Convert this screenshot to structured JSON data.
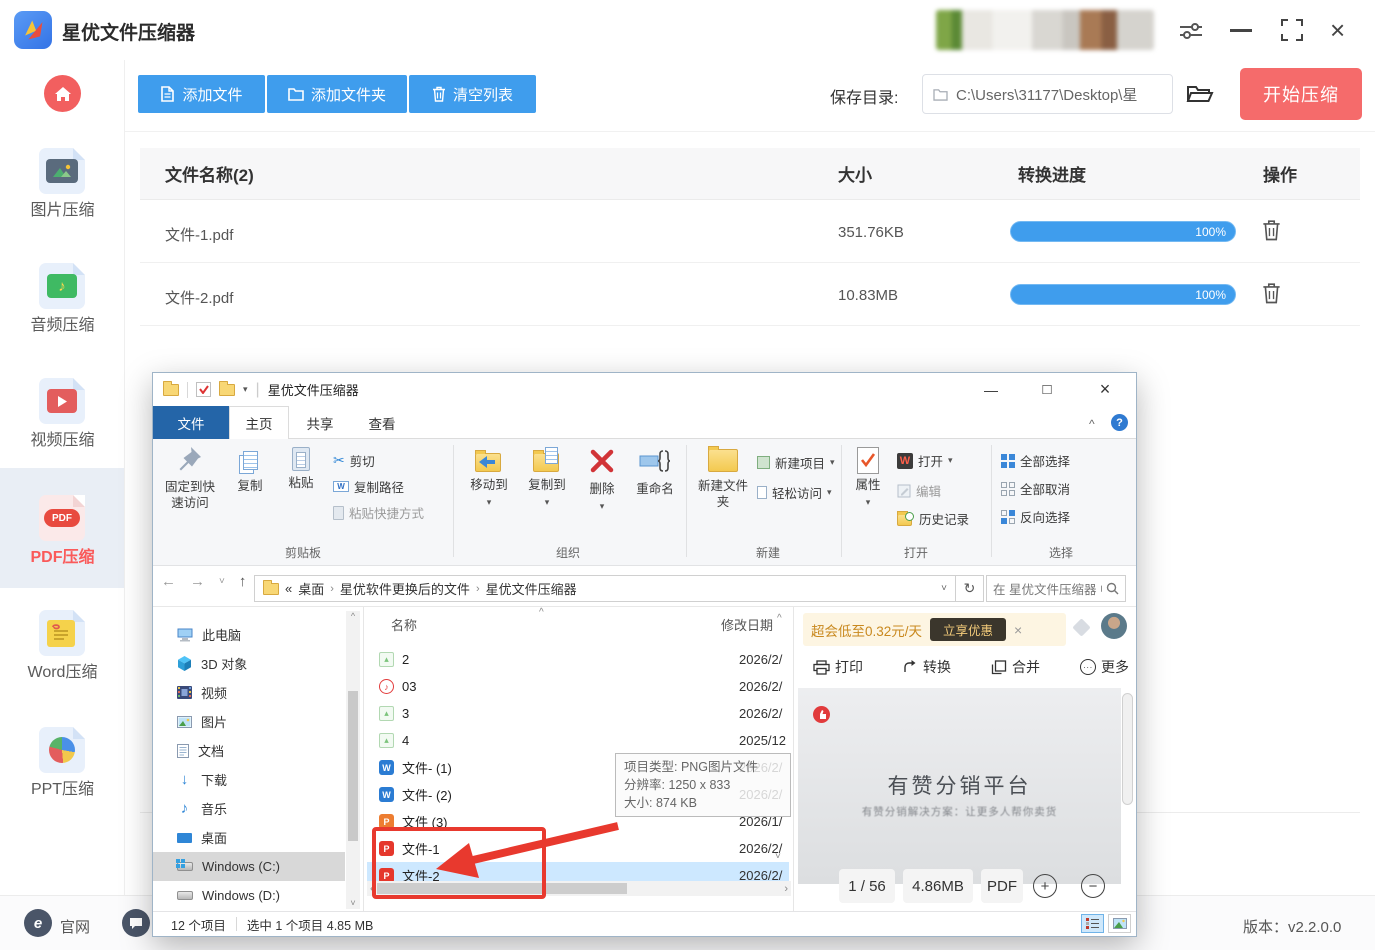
{
  "glyphs": {
    "dropdown": "▾",
    "chevron_up": "^",
    "chevron_down": "˅",
    "back": "←",
    "forward": "→",
    "up": "↑",
    "refresh": "↻",
    "prefix": "«",
    "sep": "›",
    "scissors": "✂",
    "help": "?",
    "pipe": "|",
    "scroll_left": "‹",
    "scroll_right": "›",
    "close": "×",
    "minimize": "—",
    "maximize": "□",
    "word_badge": "W",
    "ppt_badge": "P",
    "pdf_badge": "P",
    "music_note": "♪",
    "wps_w": "W",
    "more_dots": "···",
    "zoom_in": "+",
    "zoom_out": "−",
    "down_arrow": "↓",
    "pdf_text": "PDF"
  },
  "app": {
    "title": "星优文件压缩器",
    "sidebar": {
      "items": [
        {
          "label": "图片压缩"
        },
        {
          "label": "音频压缩"
        },
        {
          "label": "视频压缩"
        },
        {
          "label": "PDF压缩"
        },
        {
          "label": "Word压缩"
        },
        {
          "label": "PPT压缩"
        }
      ],
      "site_label": "官网"
    },
    "toolbar": {
      "add_file": "添加文件",
      "add_folder": "添加文件夹",
      "clear_list": "清空列表",
      "save_dir_label": "保存目录:",
      "save_dir_value": "C:\\Users\\31177\\Desktop\\星",
      "start": "开始压缩"
    },
    "table": {
      "header_name": "文件名称(2)",
      "header_size": "大小",
      "header_progress": "转换进度",
      "header_action": "操作",
      "rows": [
        {
          "name": "文件-1.pdf",
          "size": "351.76KB",
          "progress": "100%"
        },
        {
          "name": "文件-2.pdf",
          "size": "10.83MB",
          "progress": "100%"
        }
      ]
    },
    "version": "版本：v2.2.0.0"
  },
  "explorer": {
    "title": "星优文件压缩器",
    "tabs": {
      "file": "文件",
      "home": "主页",
      "share": "共享",
      "view": "查看"
    },
    "ribbon": {
      "pin_label": "固定到快速访问",
      "copy": "复制",
      "paste": "粘贴",
      "cut": "剪切",
      "copy_path": "复制路径",
      "paste_shortcut": "粘贴快捷方式",
      "group_clipboard": "剪贴板",
      "move_to": "移动到",
      "copy_to": "复制到",
      "delete": "删除",
      "rename": "重命名",
      "group_organize": "组织",
      "new_folder": "新建文件夹",
      "new_item": "新建项目",
      "easy_access": "轻松访问",
      "group_new": "新建",
      "properties": "属性",
      "open": "打开",
      "edit": "编辑",
      "history": "历史记录",
      "group_open": "打开",
      "select_all": "全部选择",
      "select_none": "全部取消",
      "invert_select": "反向选择",
      "group_select": "选择"
    },
    "address": {
      "crumb1": "桌面",
      "crumb2": "星优软件更换后的文件",
      "crumb3": "星优文件压缩器",
      "search_placeholder": "在 星优文件压缩器 中搜索"
    },
    "nav": [
      "此电脑",
      "3D 对象",
      "视频",
      "图片",
      "文档",
      "下载",
      "音乐",
      "桌面",
      "Windows (C:)",
      "Windows (D:)"
    ],
    "list": {
      "col_name": "名称",
      "col_date": "修改日期",
      "rows": [
        {
          "name": "2",
          "date": "2026/2/"
        },
        {
          "name": "03",
          "date": "2026/2/"
        },
        {
          "name": "3",
          "date": "2026/2/"
        },
        {
          "name": "4",
          "date": "2025/12"
        },
        {
          "name": "文件- (1)",
          "date": "2026/2/"
        },
        {
          "name": "文件- (2)",
          "date": "2026/2/"
        },
        {
          "name": "文件 (3)",
          "date": "2026/1/"
        },
        {
          "name": "文件-1",
          "date": "2026/2/"
        },
        {
          "name": "文件-2",
          "date": "2026/2/"
        }
      ]
    },
    "tooltip": {
      "line1": "项目类型: PNG图片文件",
      "line2": "分辨率: 1250 x 833",
      "line3": "大小: 874 KB"
    },
    "status": {
      "count": "12 个项目",
      "selection": "选中 1 个项目 4.85 MB"
    },
    "preview": {
      "ad_text": "超会低至0.32元/天",
      "ad_button": "立享优惠",
      "print": "打印",
      "convert": "转换",
      "merge": "合并",
      "more": "更多",
      "doc_title": "有赞分销平台",
      "doc_subtitle": "有赞分销解决方案：让更多人帮你卖货",
      "page_indicator": "1 / 56",
      "file_size": "4.86MB",
      "file_format": "PDF"
    }
  }
}
